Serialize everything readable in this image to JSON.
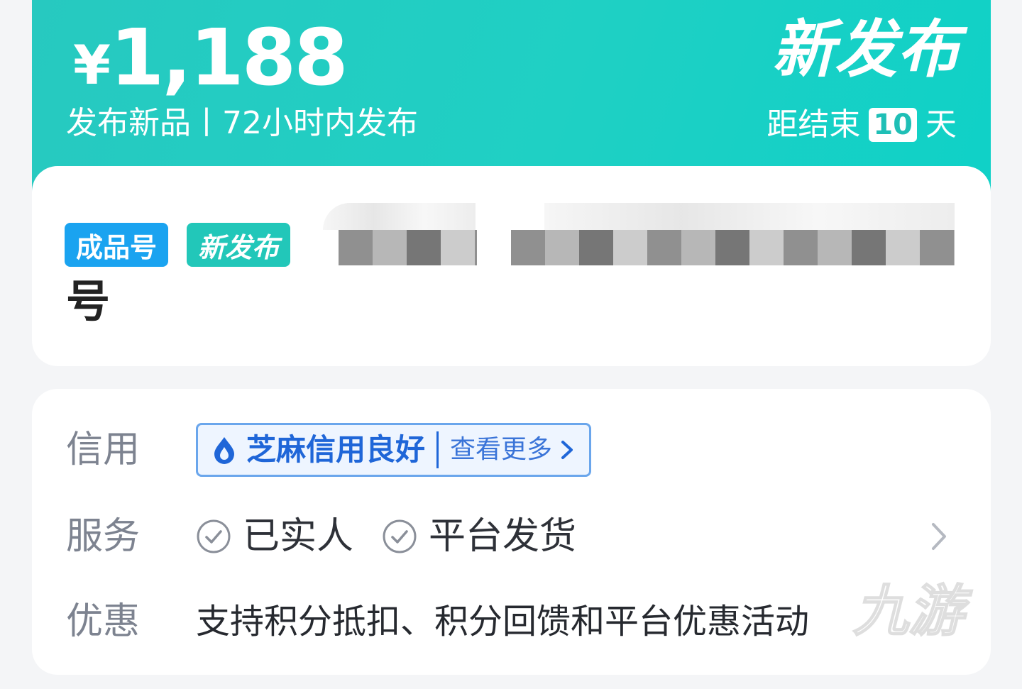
{
  "header": {
    "currency": "¥",
    "price": "1,188",
    "subtitle": "发布新品丨72小时内发布",
    "badge_title": "新发布",
    "countdown_prefix": "距结束",
    "countdown_days": "10",
    "countdown_suffix": "天"
  },
  "listing": {
    "tags": [
      "成品号",
      "新发布"
    ],
    "title_tail": "号"
  },
  "info": {
    "credit": {
      "label": "信用",
      "status": "芝麻信用良好",
      "more_label": "查看更多",
      "icon": "sesame-credit-icon"
    },
    "service": {
      "label": "服务",
      "items": [
        "已实人",
        "平台发货"
      ],
      "icon": "check-circle-icon"
    },
    "discount": {
      "label": "优惠",
      "text": "支持积分抵扣、积分回馈和平台优惠活动"
    }
  },
  "watermark": "九游",
  "colors": {
    "header_teal": "#1fd0c4",
    "tag_blue": "#1aa3f0",
    "tag_teal": "#22c7b9",
    "credit_blue": "#1f66d8",
    "label_gray": "#7d8390"
  }
}
